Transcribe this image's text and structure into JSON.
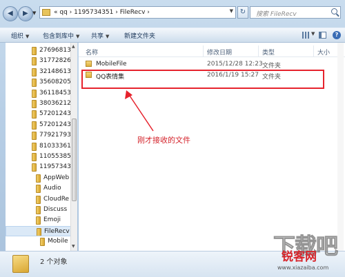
{
  "address": {
    "path": "« qq › 1195734351 › FileRecv ›"
  },
  "search": {
    "placeholder": "搜索 FileRecv"
  },
  "toolbar": {
    "organize": "组织",
    "include_in_library": "包含到库中",
    "share": "共享",
    "new_folder": "新建文件夹"
  },
  "nav_tree": [
    {
      "label": "27696813"
    },
    {
      "label": "31772826"
    },
    {
      "label": "32148613"
    },
    {
      "label": "35608205"
    },
    {
      "label": "36118453"
    },
    {
      "label": "38036212"
    },
    {
      "label": "57201243"
    },
    {
      "label": "57201243"
    },
    {
      "label": "77921793"
    },
    {
      "label": "81033361"
    },
    {
      "label": "11055385"
    },
    {
      "label": "11957343"
    },
    {
      "label": "AppWeb"
    },
    {
      "label": "Audio"
    },
    {
      "label": "CloudRe"
    },
    {
      "label": "Discuss"
    },
    {
      "label": "Emoji"
    },
    {
      "label": "FileRecv"
    },
    {
      "label": "Mobile"
    }
  ],
  "columns": {
    "name": "名称",
    "date": "修改日期",
    "type": "类型",
    "size": "大小"
  },
  "files": [
    {
      "name": "MobileFile",
      "date": "2015/12/28 12:23",
      "type": "文件夹"
    },
    {
      "name": "QQ表情集",
      "date": "2016/1/19 15:27",
      "type": "文件夹"
    }
  ],
  "annotation": {
    "text": "刚才接收的文件",
    "color": "#e6222c"
  },
  "status": {
    "count": "2 个对象"
  },
  "watermark": {
    "big": "下载吧",
    "red": "锐客网",
    "url": "www.xiazaiba.com"
  }
}
